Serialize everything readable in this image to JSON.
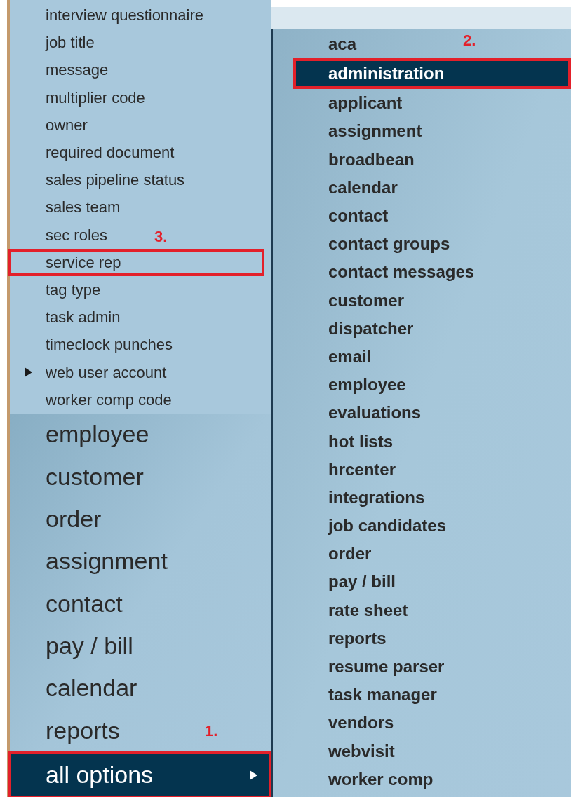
{
  "left_menu": {
    "sub_items": [
      {
        "label": "interview questionnaire",
        "expandable": false,
        "outlined": false
      },
      {
        "label": "job title",
        "expandable": false,
        "outlined": false
      },
      {
        "label": "message",
        "expandable": false,
        "outlined": false
      },
      {
        "label": "multiplier code",
        "expandable": false,
        "outlined": false
      },
      {
        "label": "owner",
        "expandable": false,
        "outlined": false
      },
      {
        "label": "required document",
        "expandable": false,
        "outlined": false
      },
      {
        "label": "sales pipeline status",
        "expandable": false,
        "outlined": false
      },
      {
        "label": "sales team",
        "expandable": false,
        "outlined": false
      },
      {
        "label": "sec roles",
        "expandable": false,
        "outlined": false
      },
      {
        "label": "service rep",
        "expandable": false,
        "outlined": true,
        "annotation": "3."
      },
      {
        "label": "tag type",
        "expandable": false,
        "outlined": false
      },
      {
        "label": "task admin",
        "expandable": false,
        "outlined": false
      },
      {
        "label": "timeclock punches",
        "expandable": false,
        "outlined": false
      },
      {
        "label": "web user account",
        "expandable": true,
        "outlined": false
      },
      {
        "label": "worker comp code",
        "expandable": false,
        "outlined": false
      }
    ],
    "main_items": [
      {
        "label": "employee",
        "selected": false,
        "outlined": false
      },
      {
        "label": "customer",
        "selected": false,
        "outlined": false
      },
      {
        "label": "order",
        "selected": false,
        "outlined": false
      },
      {
        "label": "assignment",
        "selected": false,
        "outlined": false
      },
      {
        "label": "contact",
        "selected": false,
        "outlined": false
      },
      {
        "label": "pay / bill",
        "selected": false,
        "outlined": false
      },
      {
        "label": "calendar",
        "selected": false,
        "outlined": false
      },
      {
        "label": "reports",
        "selected": false,
        "outlined": false
      },
      {
        "label": "all options",
        "selected": true,
        "outlined": true,
        "annotation": "1.",
        "expandable": true
      }
    ]
  },
  "options_menu": {
    "items": [
      {
        "label": "aca",
        "selected": false,
        "outlined": false
      },
      {
        "label": "administration",
        "selected": true,
        "outlined": true,
        "annotation": "2."
      },
      {
        "label": "applicant",
        "selected": false,
        "outlined": false
      },
      {
        "label": "assignment",
        "selected": false,
        "outlined": false
      },
      {
        "label": "broadbean",
        "selected": false,
        "outlined": false
      },
      {
        "label": "calendar",
        "selected": false,
        "outlined": false
      },
      {
        "label": "contact",
        "selected": false,
        "outlined": false
      },
      {
        "label": "contact groups",
        "selected": false,
        "outlined": false
      },
      {
        "label": "contact messages",
        "selected": false,
        "outlined": false
      },
      {
        "label": "customer",
        "selected": false,
        "outlined": false
      },
      {
        "label": "dispatcher",
        "selected": false,
        "outlined": false
      },
      {
        "label": "email",
        "selected": false,
        "outlined": false
      },
      {
        "label": "employee",
        "selected": false,
        "outlined": false
      },
      {
        "label": "evaluations",
        "selected": false,
        "outlined": false
      },
      {
        "label": "hot lists",
        "selected": false,
        "outlined": false
      },
      {
        "label": "hrcenter",
        "selected": false,
        "outlined": false
      },
      {
        "label": "integrations",
        "selected": false,
        "outlined": false
      },
      {
        "label": "job candidates",
        "selected": false,
        "outlined": false
      },
      {
        "label": "order",
        "selected": false,
        "outlined": false
      },
      {
        "label": "pay / bill",
        "selected": false,
        "outlined": false
      },
      {
        "label": "rate sheet",
        "selected": false,
        "outlined": false
      },
      {
        "label": "reports",
        "selected": false,
        "outlined": false
      },
      {
        "label": "resume parser",
        "selected": false,
        "outlined": false
      },
      {
        "label": "task manager",
        "selected": false,
        "outlined": false
      },
      {
        "label": "vendors",
        "selected": false,
        "outlined": false
      },
      {
        "label": "webvisit",
        "selected": false,
        "outlined": false
      },
      {
        "label": "worker comp",
        "selected": false,
        "outlined": false
      }
    ]
  }
}
